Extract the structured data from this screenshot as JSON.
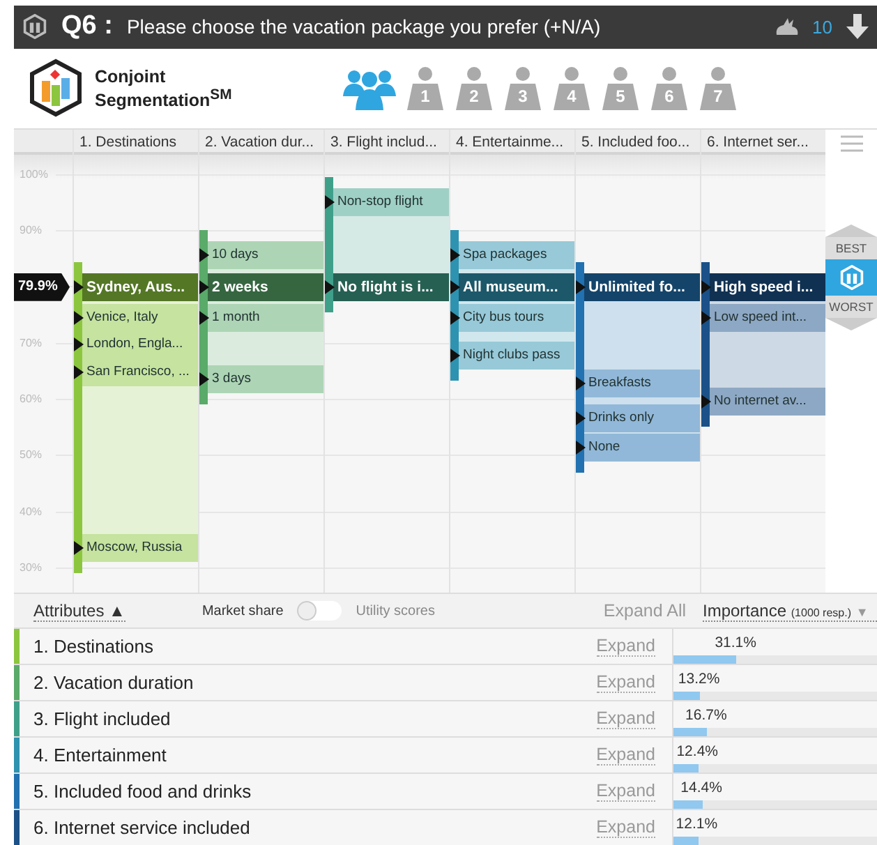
{
  "header": {
    "question_no": "Q6 :",
    "question": "Please choose the vacation package you prefer (+N/A)",
    "count": "10"
  },
  "brand": {
    "name": "Conjoint",
    "name2": "Segmentation$^{SM}$"
  },
  "segments": [
    {
      "kind": "all",
      "selected": true
    },
    {
      "label": "1",
      "kind": "person",
      "selected": false
    },
    {
      "label": "2",
      "kind": "person",
      "selected": false
    },
    {
      "label": "3",
      "kind": "person",
      "selected": false
    },
    {
      "label": "4",
      "kind": "person",
      "selected": false
    },
    {
      "label": "5",
      "kind": "person",
      "selected": false
    },
    {
      "label": "6",
      "kind": "person",
      "selected": false
    },
    {
      "label": "7",
      "kind": "person",
      "selected": false
    }
  ],
  "yticks": [
    "100%",
    "90%",
    "70%",
    "60%",
    "50%",
    "40%",
    "30%"
  ],
  "current": {
    "label": "79.9%"
  },
  "attributes": [
    {
      "header": "1. Destinations",
      "color": "#8cc63f",
      "levels": [
        {
          "label": "Sydney, Aus...",
          "selected": true
        },
        {
          "label": "Venice, Italy",
          "selected": false
        },
        {
          "label": "London, Engla...",
          "selected": false
        },
        {
          "label": "San Francisco, ...",
          "selected": false
        },
        {
          "label": "Moscow, Russia",
          "selected": false
        }
      ]
    },
    {
      "header": "2. Vacation dur...",
      "color": "#5aaa6a",
      "levels": [
        {
          "label": "10 days",
          "selected": false
        },
        {
          "label": "2 weeks",
          "selected": true
        },
        {
          "label": "1 month",
          "selected": false
        },
        {
          "label": "3 days",
          "selected": false
        }
      ]
    },
    {
      "header": "3. Flight includ...",
      "color": "#3fa08a",
      "levels": [
        {
          "label": "Non-stop flight",
          "selected": false
        },
        {
          "label": "No flight is i...",
          "selected": true
        }
      ]
    },
    {
      "header": "4. Entertainme...",
      "color": "#2e93b0",
      "levels": [
        {
          "label": "Spa packages",
          "selected": false
        },
        {
          "label": "All museum...",
          "selected": true
        },
        {
          "label": "City bus tours",
          "selected": false
        },
        {
          "label": "Night clubs pass",
          "selected": false
        }
      ]
    },
    {
      "header": "5. Included foo...",
      "color": "#2271b0",
      "levels": [
        {
          "label": "Unlimited fo...",
          "selected": true
        },
        {
          "label": "Breakfasts",
          "selected": false
        },
        {
          "label": "Drinks only",
          "selected": false
        },
        {
          "label": "None",
          "selected": false
        }
      ]
    },
    {
      "header": "6. Internet ser...",
      "color": "#1b5188",
      "levels": [
        {
          "label": "High speed i...",
          "selected": true
        },
        {
          "label": "Low speed int...",
          "selected": false
        },
        {
          "label": "No internet av...",
          "selected": false
        }
      ]
    }
  ],
  "best_label": "BEST",
  "worst_label": "WORST",
  "toolbar": {
    "attributes": "Attributes",
    "sort_arrow": "▲",
    "left_label": "Market share",
    "right_label": "Utility scores",
    "toggle_on": false,
    "expand_all": "Expand All",
    "importance": "Importance",
    "importance_note": "(1000 resp.)",
    "importance_arrow": "▼"
  },
  "rows": [
    {
      "name": "1. Destinations",
      "expand": "Expand",
      "importance": "31.1%",
      "level": 0.311,
      "color": "#8cc63f"
    },
    {
      "name": "2. Vacation duration",
      "expand": "Expand",
      "importance": "13.2%",
      "level": 0.132,
      "color": "#5aaa6a"
    },
    {
      "name": "3. Flight included",
      "expand": "Expand",
      "importance": "16.7%",
      "level": 0.167,
      "color": "#3fa08a"
    },
    {
      "name": "4. Entertainment",
      "expand": "Expand",
      "importance": "12.4%",
      "level": 0.124,
      "color": "#2e93b0"
    },
    {
      "name": "5. Included food and drinks",
      "expand": "Expand",
      "importance": "14.4%",
      "level": 0.144,
      "color": "#2271b0"
    },
    {
      "name": "6. Internet service included",
      "expand": "Expand",
      "importance": "12.1%",
      "level": 0.121,
      "color": "#1b5188"
    }
  ]
}
